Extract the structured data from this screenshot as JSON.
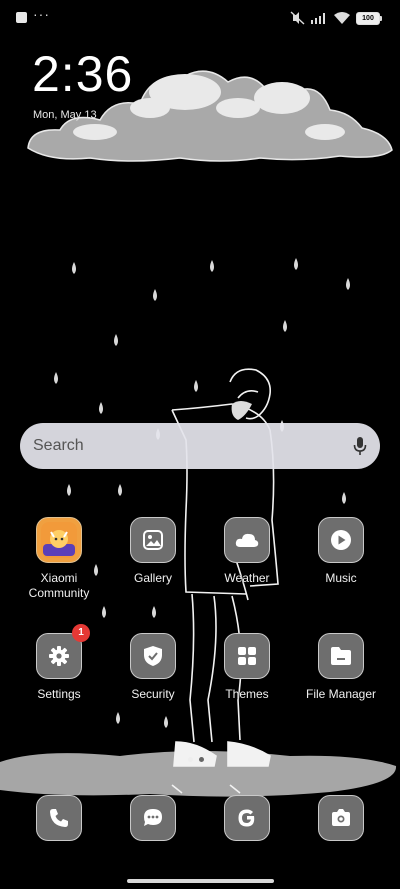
{
  "status_bar": {
    "dots": "···",
    "battery": "100",
    "icons": [
      "mute-icon",
      "signal-icon",
      "wifi-icon",
      "battery-icon"
    ]
  },
  "clock": {
    "time": "2:36",
    "date": "Mon, May 13"
  },
  "search": {
    "placeholder": "Search",
    "mic_icon": "microphone-icon"
  },
  "apps_row1": [
    {
      "label_line1": "Xiaomi",
      "label_line2": "Community",
      "icon": "xiaomi-community-icon"
    },
    {
      "label_line1": "Gallery",
      "label_line2": "",
      "icon": "gallery-icon"
    },
    {
      "label_line1": "Weather",
      "label_line2": "",
      "icon": "weather-icon"
    },
    {
      "label_line1": "Music",
      "label_line2": "",
      "icon": "music-icon"
    }
  ],
  "apps_row2": [
    {
      "label": "Settings",
      "icon": "gear-icon",
      "badge": "1"
    },
    {
      "label": "Security",
      "icon": "shield-icon"
    },
    {
      "label": "Themes",
      "icon": "themes-icon"
    },
    {
      "label": "File Manager",
      "icon": "folder-icon"
    }
  ],
  "dock": [
    {
      "icon": "phone-icon"
    },
    {
      "icon": "messages-icon"
    },
    {
      "icon": "google-icon"
    },
    {
      "icon": "camera-icon"
    }
  ],
  "colors": {
    "background": "#000000",
    "badge": "#e53935",
    "search_bg": "#e4e4ec"
  }
}
